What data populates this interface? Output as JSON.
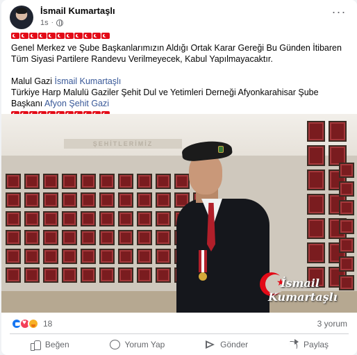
{
  "post": {
    "author": "İsmail Kumartaşlı",
    "time": "1s",
    "dot": "·",
    "more": "···",
    "paragraph1": "Genel Merkez ve Şube Başkanlarımızın Aldığı Ortak Karar Gereği Bu Günden İtibaren Tüm Siyasi Partilere Randevu Verilmeyecek, Kabul Yapılmayacaktır.",
    "sig_prefix": "Malul Gazi ",
    "sig_name": "İsmail Kumartaşlı",
    "title_text": "Türkiye Harp Malulü Gaziler Şehit Dul ve Yetimleri Derneği Afyonkarahisar Şube Başkanı ",
    "title_link": "Afyon Şehit Gazi",
    "flag_count_1": 11,
    "flag_count_2": 11
  },
  "photo": {
    "sign_text": "ŞEHİTLERİMİZ",
    "watermark_line1": "İsmail",
    "watermark_line2": "Kumartaşlı"
  },
  "stats": {
    "reaction_count": "18",
    "comment_count": "3 yorum"
  },
  "actions": {
    "like": "Beğen",
    "comment": "Yorum Yap",
    "send": "Gönder",
    "share": "Paylaş"
  },
  "colors": {
    "flag_red": "#e30a17",
    "link_blue": "#385898",
    "like_blue": "#1877f2",
    "love_red": "#f33e58",
    "care_yellow": "#f7b125",
    "muted_text": "#65676b"
  }
}
